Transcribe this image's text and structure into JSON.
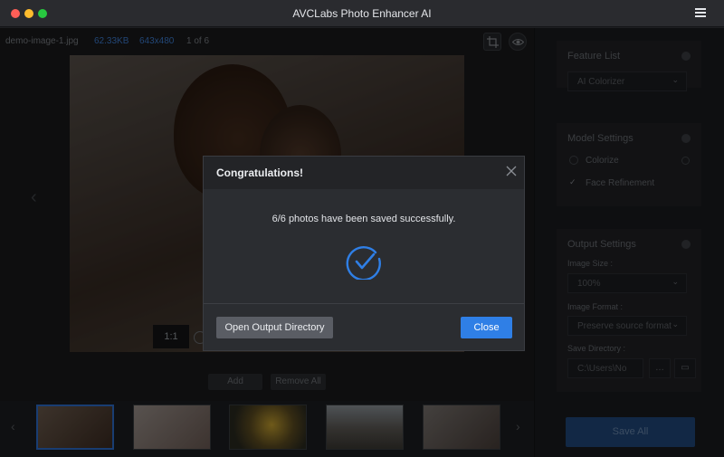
{
  "window": {
    "title": "AVCLabs Photo Enhancer AI",
    "menu_icon": "hamburger-menu-icon"
  },
  "file_info": {
    "name": "demo-image-1.jpg",
    "size": "62.33KB",
    "dimensions": "643x480",
    "count": "1 of 6"
  },
  "toolbar": {
    "crop_icon": "crop-icon",
    "eye_icon": "eye-icon"
  },
  "preview": {
    "zoom_label": "1:1"
  },
  "list_actions": {
    "add_label": "Add",
    "remove_all_label": "Remove All"
  },
  "thumbnails": [
    {
      "selected": true
    },
    {
      "selected": false
    },
    {
      "selected": false
    },
    {
      "selected": false
    },
    {
      "selected": false
    }
  ],
  "right_panel": {
    "feature_list": {
      "title": "Feature List",
      "selected": "AI Colorizer"
    },
    "model_settings": {
      "title": "Model Settings",
      "colorize_label": "Colorize",
      "face_refinement_label": "Face Refinement",
      "face_refinement_checked": true
    },
    "output_settings": {
      "title": "Output Settings",
      "image_size_label": "Image Size :",
      "image_size_value": "100%",
      "image_format_label": "Image Format :",
      "image_format_value": "Preserve source format",
      "save_directory_label": "Save Directory :",
      "save_directory_value": "C:\\Users\\No",
      "browse_label": "…"
    },
    "save_all_label": "Save All"
  },
  "dialog": {
    "title": "Congratulations!",
    "message": "6/6 photos have been saved successfully.",
    "open_dir_label": "Open Output Directory",
    "close_label": "Close"
  },
  "colors": {
    "accent_blue": "#2f7fe6",
    "link_blue": "#3e7fd6",
    "check_blue": "#2f7fe6"
  }
}
